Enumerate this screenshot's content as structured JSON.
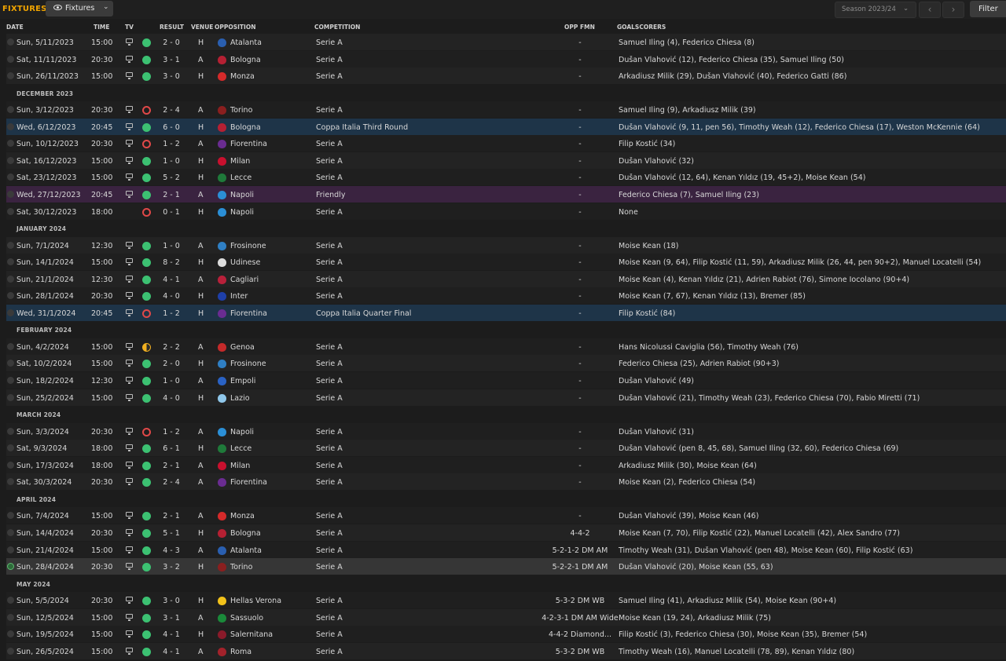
{
  "toolbar": {
    "title": "FIXTURES",
    "view_button": "Fixtures",
    "season_select": "Season 2023/24",
    "filter_button": "Filter",
    "prev_icon": "chevron-left-icon",
    "next_icon": "chevron-right-icon"
  },
  "columns": {
    "date": "DATE",
    "time": "TIME",
    "tv": "TV",
    "result": "RESULT",
    "venue": "VENUE",
    "opposition": "OPPOSITION",
    "competition": "COMPETITION",
    "opp_fmn": "OPP FMN",
    "goalscorers": "GOALSCORERS"
  },
  "colors": {
    "accent": "#f0a400",
    "win": "#3cc172",
    "loss": "#e04848",
    "draw": "#f2b020",
    "cup_row": "#1e3448",
    "friendly_row": "#3a2340"
  },
  "rows": [
    {
      "type": "match",
      "date": "Sun, 5/11/2023",
      "time": "15:00",
      "tv": true,
      "result": "w",
      "score": "2 - 0",
      "venue": "H",
      "opposition": "Atalanta",
      "crest": "#2a5fb0",
      "competition": "Serie A",
      "opp_fmn": "-",
      "scorers": "Samuel Iling (4), Federico Chiesa (8)"
    },
    {
      "type": "match",
      "date": "Sat, 11/11/2023",
      "time": "20:30",
      "tv": true,
      "result": "w",
      "score": "3 - 1",
      "venue": "A",
      "opposition": "Bologna",
      "crest": "#b52033",
      "competition": "Serie A",
      "opp_fmn": "-",
      "scorers": "Dušan Vlahović (12), Federico Chiesa (35), Samuel Iling (50)"
    },
    {
      "type": "match",
      "date": "Sun, 26/11/2023",
      "time": "15:00",
      "tv": true,
      "result": "w",
      "score": "3 - 0",
      "venue": "H",
      "opposition": "Monza",
      "crest": "#d52a2a",
      "competition": "Serie A",
      "opp_fmn": "-",
      "scorers": "Arkadiusz Milik (29), Dušan Vlahović (40), Federico Gatti (86)"
    },
    {
      "type": "month",
      "label": "DECEMBER 2023"
    },
    {
      "type": "match",
      "date": "Sun, 3/12/2023",
      "time": "20:30",
      "tv": true,
      "result": "l",
      "score": "2 - 4",
      "venue": "A",
      "opposition": "Torino",
      "crest": "#8a1f1f",
      "competition": "Serie A",
      "opp_fmn": "-",
      "scorers": "Samuel Iling (9), Arkadiusz Milik (39)"
    },
    {
      "type": "match",
      "date": "Wed, 6/12/2023",
      "time": "20:45",
      "tv": true,
      "result": "w",
      "score": "6 - 0",
      "venue": "H",
      "opposition": "Bologna",
      "crest": "#b52033",
      "competition": "Coppa Italia Third Round",
      "opp_fmn": "-",
      "scorers": "Dušan Vlahović (9, 11, pen 56), Timothy Weah (12), Federico Chiesa (17), Weston McKennie (64)",
      "hl": "cup"
    },
    {
      "type": "match",
      "date": "Sun, 10/12/2023",
      "time": "20:30",
      "tv": true,
      "result": "l",
      "score": "1 - 2",
      "venue": "A",
      "opposition": "Fiorentina",
      "crest": "#6a2c91",
      "competition": "Serie A",
      "opp_fmn": "-",
      "scorers": "Filip Kostić (34)"
    },
    {
      "type": "match",
      "date": "Sat, 16/12/2023",
      "time": "15:00",
      "tv": true,
      "result": "w",
      "score": "1 - 0",
      "venue": "H",
      "opposition": "Milan",
      "crest": "#c8102e",
      "competition": "Serie A",
      "opp_fmn": "-",
      "scorers": "Dušan Vlahović (32)"
    },
    {
      "type": "match",
      "date": "Sat, 23/12/2023",
      "time": "15:00",
      "tv": true,
      "result": "w",
      "score": "5 - 2",
      "venue": "H",
      "opposition": "Lecce",
      "crest": "#1f7a3a",
      "competition": "Serie A",
      "opp_fmn": "-",
      "scorers": "Dušan Vlahović (12, 64), Kenan Yıldız (19, 45+2), Moise Kean (54)"
    },
    {
      "type": "match",
      "date": "Wed, 27/12/2023",
      "time": "20:45",
      "tv": true,
      "result": "w",
      "score": "2 - 1",
      "venue": "A",
      "opposition": "Napoli",
      "crest": "#2b8fd6",
      "competition": "Friendly",
      "opp_fmn": "-",
      "scorers": "Federico Chiesa (7), Samuel Iling (23)",
      "hl": "friendly"
    },
    {
      "type": "match",
      "date": "Sat, 30/12/2023",
      "time": "18:00",
      "tv": false,
      "result": "l",
      "score": "0 - 1",
      "venue": "H",
      "opposition": "Napoli",
      "crest": "#2b8fd6",
      "competition": "Serie A",
      "opp_fmn": "-",
      "scorers": "None"
    },
    {
      "type": "month",
      "label": "JANUARY 2024"
    },
    {
      "type": "match",
      "date": "Sun, 7/1/2024",
      "time": "12:30",
      "tv": true,
      "result": "w",
      "score": "1 - 0",
      "venue": "A",
      "opposition": "Frosinone",
      "crest": "#2f7fc4",
      "competition": "Serie A",
      "opp_fmn": "-",
      "scorers": "Moise Kean (18)"
    },
    {
      "type": "match",
      "date": "Sun, 14/1/2024",
      "time": "15:00",
      "tv": true,
      "result": "w",
      "score": "8 - 2",
      "venue": "H",
      "opposition": "Udinese",
      "crest": "#dcdcdc",
      "competition": "Serie A",
      "opp_fmn": "-",
      "scorers": "Moise Kean (9, 64), Filip Kostić (11, 59), Arkadiusz Milik (26, 44, pen 90+2), Manuel Locatelli (54)"
    },
    {
      "type": "match",
      "date": "Sun, 21/1/2024",
      "time": "12:30",
      "tv": true,
      "result": "w",
      "score": "4 - 1",
      "venue": "A",
      "opposition": "Cagliari",
      "crest": "#b8203a",
      "competition": "Serie A",
      "opp_fmn": "-",
      "scorers": "Moise Kean (4), Kenan Yıldız (21), Adrien Rabiot (76), Simone Iocolano (90+4)"
    },
    {
      "type": "match",
      "date": "Sun, 28/1/2024",
      "time": "20:30",
      "tv": true,
      "result": "w",
      "score": "4 - 0",
      "venue": "H",
      "opposition": "Inter",
      "crest": "#1e3fa8",
      "competition": "Serie A",
      "opp_fmn": "-",
      "scorers": "Moise Kean (7, 67), Kenan Yıldız (13), Bremer (85)"
    },
    {
      "type": "match",
      "date": "Wed, 31/1/2024",
      "time": "20:45",
      "tv": true,
      "result": "l",
      "score": "1 - 2",
      "venue": "H",
      "opposition": "Fiorentina",
      "crest": "#6a2c91",
      "competition": "Coppa Italia Quarter Final",
      "opp_fmn": "-",
      "scorers": "Filip Kostić (84)",
      "hl": "cup"
    },
    {
      "type": "month",
      "label": "FEBRUARY 2024"
    },
    {
      "type": "match",
      "date": "Sun, 4/2/2024",
      "time": "15:00",
      "tv": true,
      "result": "d",
      "score": "2 - 2",
      "venue": "A",
      "opposition": "Genoa",
      "crest": "#c42a2a",
      "competition": "Serie A",
      "opp_fmn": "-",
      "scorers": "Hans Nicolussi Caviglia (56), Timothy Weah (76)"
    },
    {
      "type": "match",
      "date": "Sat, 10/2/2024",
      "time": "15:00",
      "tv": true,
      "result": "w",
      "score": "2 - 0",
      "venue": "H",
      "opposition": "Frosinone",
      "crest": "#2f7fc4",
      "competition": "Serie A",
      "opp_fmn": "-",
      "scorers": "Federico Chiesa (25), Adrien Rabiot (90+3)"
    },
    {
      "type": "match",
      "date": "Sun, 18/2/2024",
      "time": "12:30",
      "tv": true,
      "result": "w",
      "score": "1 - 0",
      "venue": "A",
      "opposition": "Empoli",
      "crest": "#2a62c4",
      "competition": "Serie A",
      "opp_fmn": "-",
      "scorers": "Dušan Vlahović (49)"
    },
    {
      "type": "match",
      "date": "Sun, 25/2/2024",
      "time": "15:00",
      "tv": true,
      "result": "w",
      "score": "4 - 0",
      "venue": "H",
      "opposition": "Lazio",
      "crest": "#8fc7ea",
      "competition": "Serie A",
      "opp_fmn": "-",
      "scorers": "Dušan Vlahović (21), Timothy Weah (23), Federico Chiesa (70), Fabio Miretti (71)"
    },
    {
      "type": "month",
      "label": "MARCH 2024"
    },
    {
      "type": "match",
      "date": "Sun, 3/3/2024",
      "time": "20:30",
      "tv": true,
      "result": "l",
      "score": "1 - 2",
      "venue": "A",
      "opposition": "Napoli",
      "crest": "#2b8fd6",
      "competition": "Serie A",
      "opp_fmn": "-",
      "scorers": "Dušan Vlahović (31)"
    },
    {
      "type": "match",
      "date": "Sat, 9/3/2024",
      "time": "18:00",
      "tv": true,
      "result": "w",
      "score": "6 - 1",
      "venue": "H",
      "opposition": "Lecce",
      "crest": "#1f7a3a",
      "competition": "Serie A",
      "opp_fmn": "-",
      "scorers": "Dušan Vlahović (pen 8, 45, 68), Samuel Iling (32, 60), Federico Chiesa (69)"
    },
    {
      "type": "match",
      "date": "Sun, 17/3/2024",
      "time": "18:00",
      "tv": true,
      "result": "w",
      "score": "2 - 1",
      "venue": "A",
      "opposition": "Milan",
      "crest": "#c8102e",
      "competition": "Serie A",
      "opp_fmn": "-",
      "scorers": "Arkadiusz Milik (30), Moise Kean (64)"
    },
    {
      "type": "match",
      "date": "Sat, 30/3/2024",
      "time": "20:30",
      "tv": true,
      "result": "w",
      "score": "2 - 4",
      "venue": "A",
      "opposition": "Fiorentina",
      "crest": "#6a2c91",
      "competition": "Serie A",
      "opp_fmn": "-",
      "scorers": "Moise Kean (2), Federico Chiesa (54)"
    },
    {
      "type": "month",
      "label": "APRIL 2024"
    },
    {
      "type": "match",
      "date": "Sun, 7/4/2024",
      "time": "15:00",
      "tv": true,
      "result": "w",
      "score": "2 - 1",
      "venue": "A",
      "opposition": "Monza",
      "crest": "#d52a2a",
      "competition": "Serie A",
      "opp_fmn": "-",
      "scorers": "Dušan Vlahović (39), Moise Kean (46)"
    },
    {
      "type": "match",
      "date": "Sun, 14/4/2024",
      "time": "20:30",
      "tv": true,
      "result": "w",
      "score": "5 - 1",
      "venue": "H",
      "opposition": "Bologna",
      "crest": "#b52033",
      "competition": "Serie A",
      "opp_fmn": "4-4-2",
      "scorers": "Moise Kean (7, 70), Filip Kostić (22), Manuel Locatelli (42), Alex Sandro (77)"
    },
    {
      "type": "match",
      "date": "Sun, 21/4/2024",
      "time": "15:00",
      "tv": true,
      "result": "w",
      "score": "4 - 3",
      "venue": "A",
      "opposition": "Atalanta",
      "crest": "#2a5fb0",
      "competition": "Serie A",
      "opp_fmn": "5-2-1-2 DM AM",
      "scorers": "Timothy Weah (31), Dušan Vlahović (pen 48), Moise Kean (60), Filip Kostić (63)"
    },
    {
      "type": "match",
      "date": "Sun, 28/4/2024",
      "time": "20:30",
      "tv": true,
      "result": "w",
      "score": "3 - 2",
      "venue": "H",
      "opposition": "Torino",
      "crest": "#8a1f1f",
      "competition": "Serie A",
      "opp_fmn": "5-2-2-1 DM AM",
      "scorers": "Dušan Vlahović (20), Moise Kean (55, 63)",
      "hl": "sel",
      "done": true
    },
    {
      "type": "month",
      "label": "MAY 2024"
    },
    {
      "type": "match",
      "date": "Sun, 5/5/2024",
      "time": "20:30",
      "tv": true,
      "result": "w",
      "score": "3 - 0",
      "venue": "H",
      "opposition": "Hellas Verona",
      "crest": "#f2c21a",
      "competition": "Serie A",
      "opp_fmn": "5-3-2 DM WB",
      "scorers": "Samuel Iling (41), Arkadiusz Milik (54), Moise Kean (90+4)"
    },
    {
      "type": "match",
      "date": "Sun, 12/5/2024",
      "time": "15:00",
      "tv": true,
      "result": "w",
      "score": "3 - 1",
      "venue": "A",
      "opposition": "Sassuolo",
      "crest": "#1a8a3a",
      "competition": "Serie A",
      "opp_fmn": "4-2-3-1 DM AM Wide",
      "scorers": "Moise Kean (19, 24), Arkadiusz Milik (75)"
    },
    {
      "type": "match",
      "date": "Sun, 19/5/2024",
      "time": "15:00",
      "tv": true,
      "result": "w",
      "score": "4 - 1",
      "venue": "H",
      "opposition": "Salernitana",
      "crest": "#8a1a2a",
      "competition": "Serie A",
      "opp_fmn": "4-4-2 Diamond...",
      "scorers": "Filip Kostić (3), Federico Chiesa (30), Moise Kean (35), Bremer (54)"
    },
    {
      "type": "match",
      "date": "Sun, 26/5/2024",
      "time": "15:00",
      "tv": true,
      "result": "w",
      "score": "4 - 1",
      "venue": "A",
      "opposition": "Roma",
      "crest": "#a3222b",
      "competition": "Serie A",
      "opp_fmn": "5-3-2 DM WB",
      "scorers": "Timothy Weah (16), Manuel Locatelli (78, 89), Kenan Yıldız (80)"
    }
  ]
}
